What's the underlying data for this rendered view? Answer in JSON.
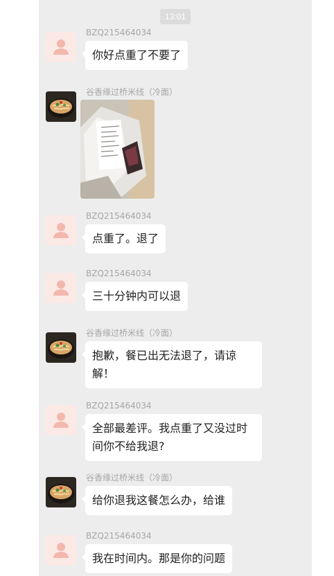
{
  "time": "13:01",
  "messages": [
    {
      "sender": "BZQ215464034",
      "text": "你好点重了不要了"
    },
    {
      "sender": "谷香缘过桥米线（冷面）",
      "image_desc": "receipt-photo"
    },
    {
      "sender": "BZQ215464034",
      "text": "点重了。退了"
    },
    {
      "sender": "BZQ215464034",
      "text": "三十分钟内可以退"
    },
    {
      "sender": "谷香缘过桥米线（冷面）",
      "text": "抱歉，餐已出无法退了，请谅解！"
    },
    {
      "sender": "BZQ215464034",
      "text": "全部最差评。我点重了又没过时间你不给我退?"
    },
    {
      "sender": "谷香缘过桥米线（冷面）",
      "text": "给你退我这餐怎么办，给谁"
    },
    {
      "sender": "BZQ215464034",
      "text": "我在时间内。那是你的问题"
    }
  ],
  "colors": {
    "chat_bg": "#ededed",
    "bubble": "#ffffff",
    "user_avatar_bg": "#fbe9e6",
    "user_avatar_fg": "#f3b8ad"
  }
}
